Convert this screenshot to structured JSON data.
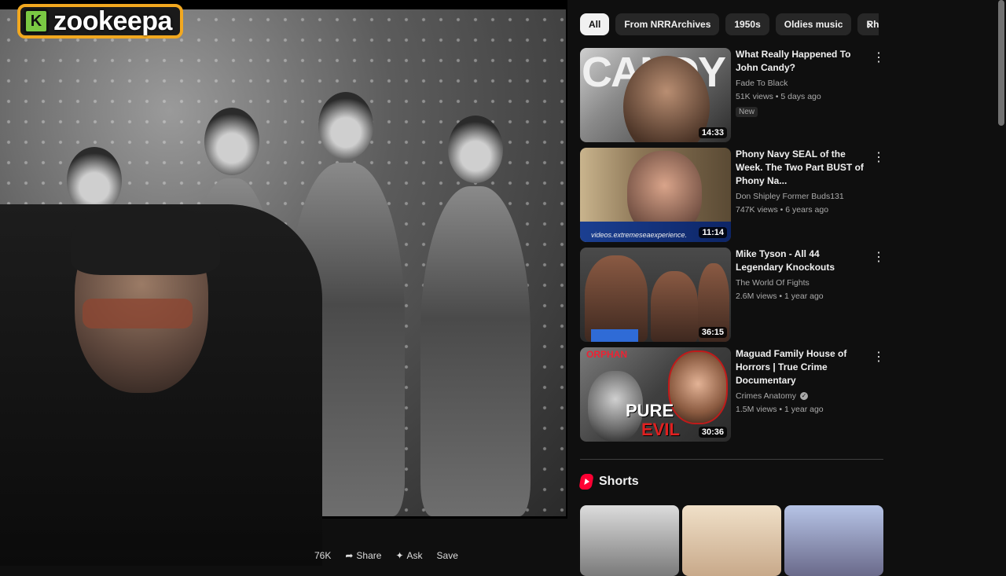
{
  "overlay": {
    "logo_letter": "K",
    "logo_text": "zookeepa"
  },
  "player": {
    "actions": [
      "76K",
      "Share",
      "Ask",
      "Save"
    ]
  },
  "chips": [
    "All",
    "From NRRArchives",
    "1950s",
    "Oldies music",
    "Rhythm"
  ],
  "recommendations": [
    {
      "title": "What Really Happened To John Candy?",
      "channel": "Fade To Black",
      "stats": "51K views • 5 days ago",
      "badge": "New",
      "duration": "14:33",
      "thumb_text": "CANDY"
    },
    {
      "title": "Phony Navy SEAL of the Week. The Two Part BUST of Phony Na...",
      "channel": "Don Shipley Former Buds131",
      "stats": "747K views • 6 years ago",
      "duration": "11:14",
      "thumb_text": "videos.extremeseaexperience."
    },
    {
      "title": "Mike Tyson - All 44 Legendary Knockouts",
      "channel": "The World Of Fights",
      "stats": "2.6M views • 1 year ago",
      "duration": "36:15"
    },
    {
      "title": "Maguad Family House of Horrors | True Crime Documentary",
      "channel": "Crimes Anatomy",
      "stats": "1.5M views • 1 year ago",
      "duration": "30:36",
      "thumb_text_1": "ORPHAN",
      "thumb_text_2": "PURE",
      "thumb_text_3": "EVIL"
    }
  ],
  "shorts": {
    "title": "Shorts"
  },
  "icons": {
    "chip_next": "chevron-right-icon",
    "more": "more-vert-icon",
    "verified": "verified-icon"
  },
  "colors": {
    "background": "#0f0f0f",
    "chip": "#272727",
    "chip_active": "#f1f1f1",
    "shorts_red": "#ff0033",
    "logo_border": "#f2a81f"
  }
}
